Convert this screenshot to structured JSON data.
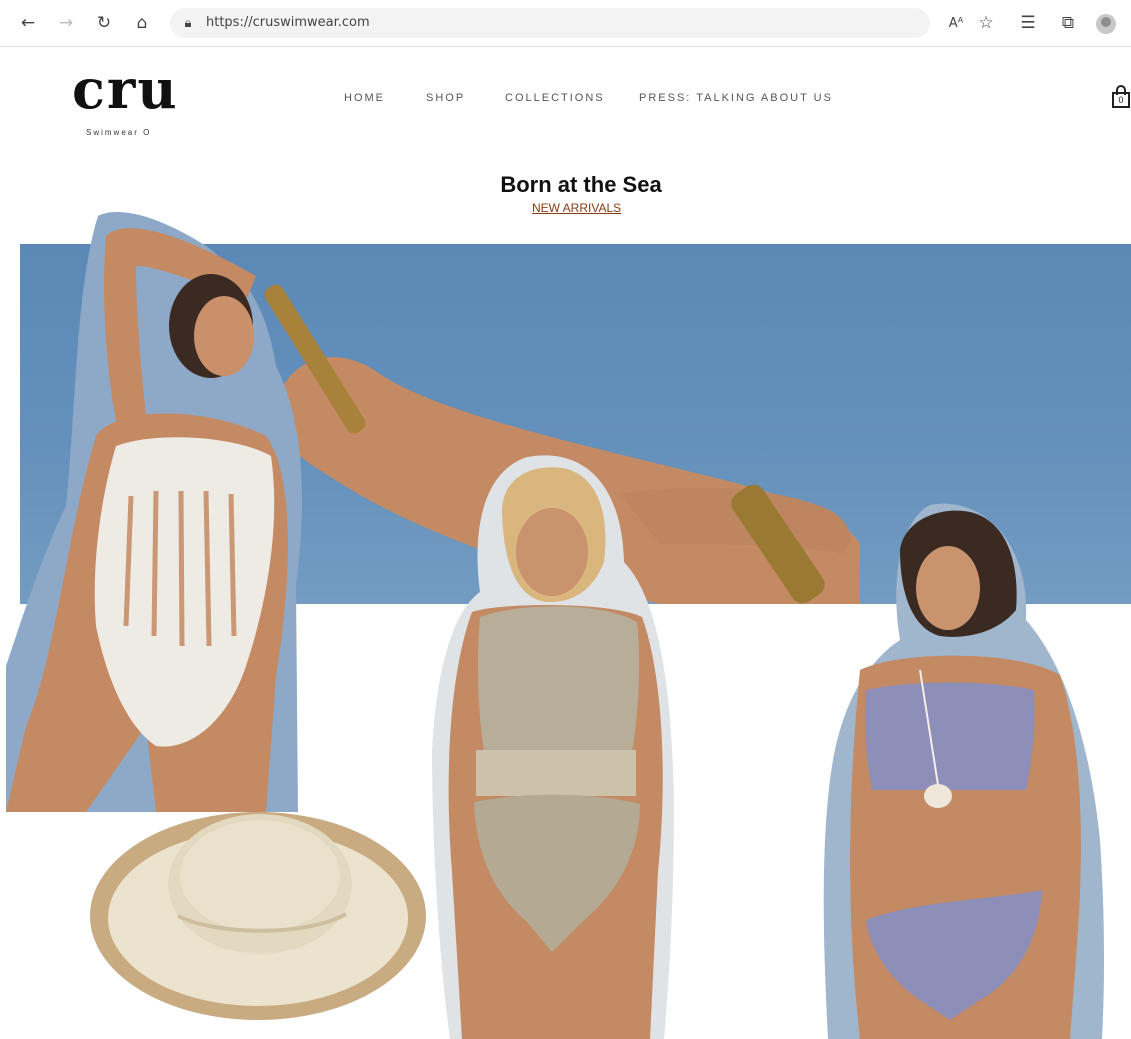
{
  "browser": {
    "url": "https://cruswimwear.com",
    "icons": [
      "back-arrow-icon",
      "forward-arrow-icon",
      "refresh-icon",
      "home-icon",
      "lock-icon",
      "read-aloud-icon",
      "add-favorite-icon",
      "favorites-icon",
      "collections-icon",
      "profile-icon"
    ]
  },
  "brand": {
    "logo_text": "cru",
    "tagline": "Swimwear O"
  },
  "nav": {
    "home": "HOME",
    "shop": "SHOP",
    "collections": "COLLECTIONS",
    "press": "PRESS: TALKING ABOUT US"
  },
  "cart": {
    "count": "0"
  },
  "hero": {
    "title": "Born at the Sea",
    "link": "NEW ARRIVALS"
  },
  "colors": {
    "sky": "#6591bc",
    "link": "#8a3a14",
    "skin": "#c98f6a",
    "white_suit": "#eeeae4",
    "beige_suit": "#b8ad98",
    "lavender_suit": "#8e8fb8",
    "hat": "#ece3cf"
  }
}
